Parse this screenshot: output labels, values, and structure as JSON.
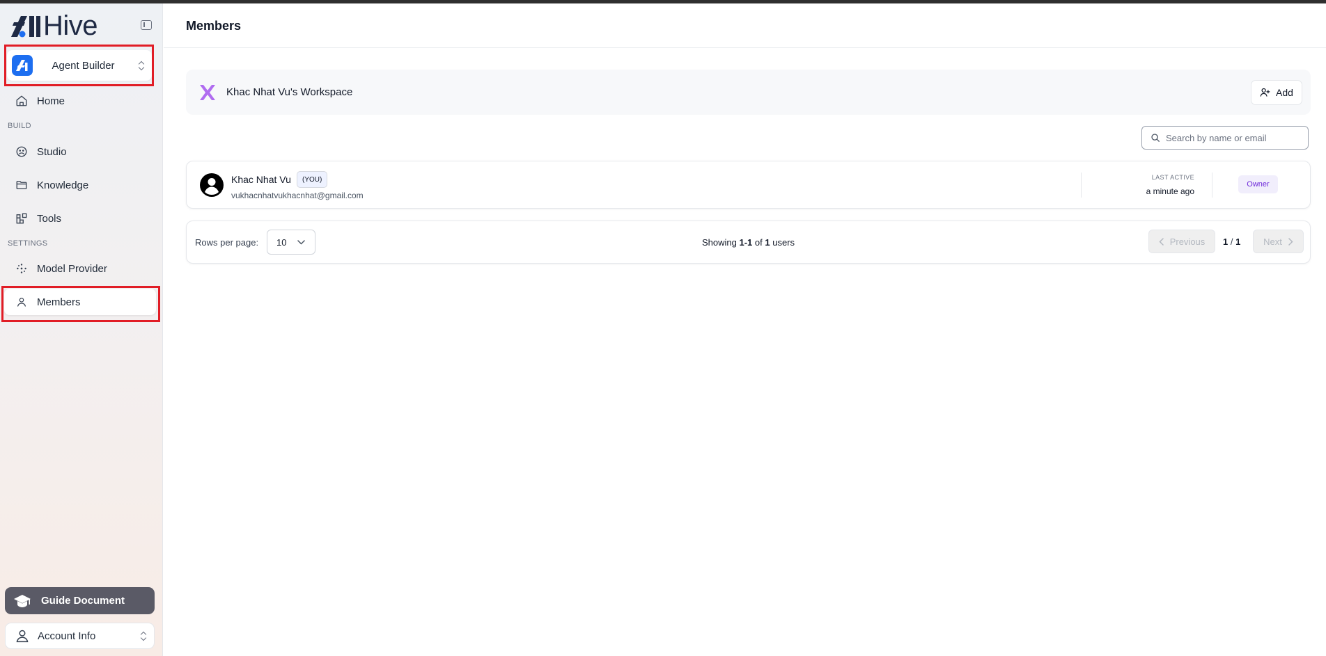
{
  "brand": {
    "logo_text": "Hive"
  },
  "app_switcher": {
    "label": "Agent Builder"
  },
  "sidebar": {
    "home": "Home",
    "sections": {
      "build": "BUILD",
      "settings": "SETTINGS"
    },
    "items": [
      {
        "label": "Studio"
      },
      {
        "label": "Knowledge"
      },
      {
        "label": "Tools"
      },
      {
        "label": "Model Provider"
      },
      {
        "label": "Members"
      }
    ],
    "guide": "Guide Document",
    "account": "Account Info"
  },
  "page": {
    "title": "Members"
  },
  "workspace": {
    "name": "Khac Nhat Vu's Workspace",
    "add_label": "Add"
  },
  "search": {
    "placeholder": "Search by name or email",
    "value": ""
  },
  "members": [
    {
      "name": "Khac Nhat Vu",
      "you_badge": "(YOU)",
      "email": "vukhacnhatvukhacnhat@gmail.com",
      "last_active_label": "LAST ACTIVE",
      "last_active": "a minute ago",
      "role": "Owner"
    }
  ],
  "pagination": {
    "rows_label": "Rows per page:",
    "rows_value": "10",
    "showing_prefix": "Showing",
    "range": "1-1",
    "of": "of",
    "total": "1",
    "suffix": "users",
    "prev": "Previous",
    "next": "Next",
    "current": "1",
    "sep": "/",
    "pages": "1"
  },
  "colors": {
    "accent": "#1d6ef0",
    "highlight": "#e11d26",
    "owner": "#6d28d9",
    "workspace_icon": "#b06cf0"
  }
}
